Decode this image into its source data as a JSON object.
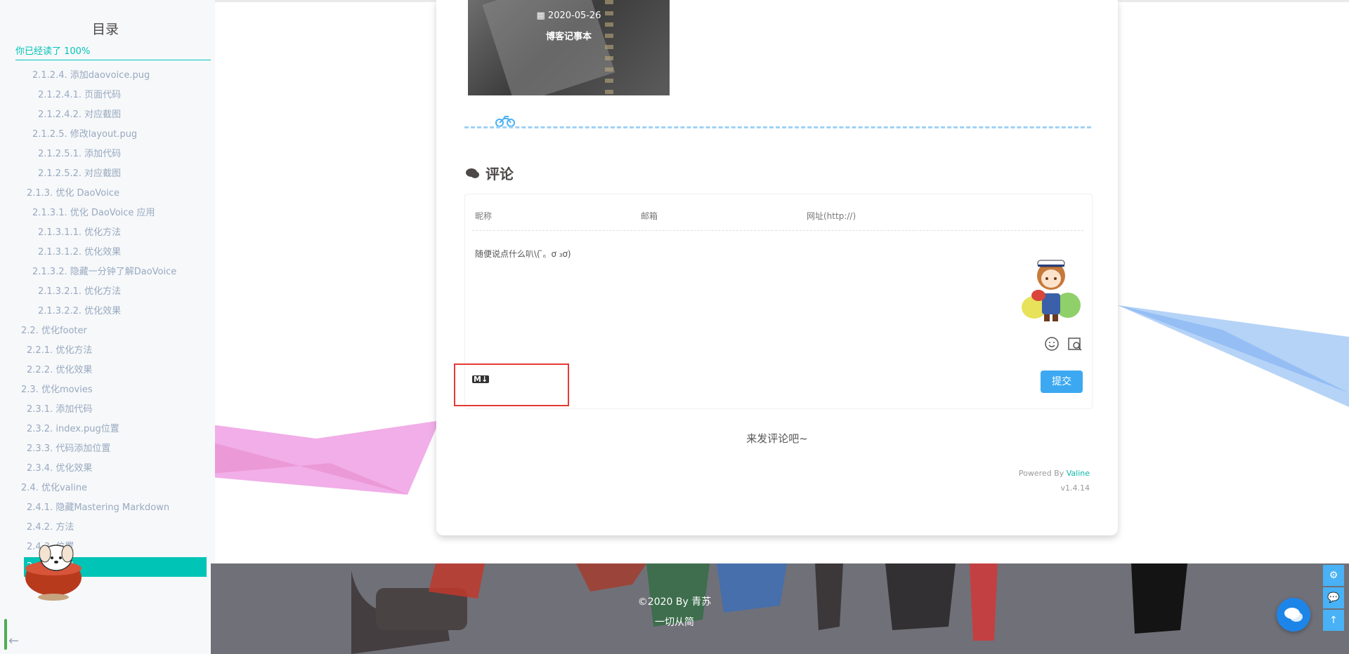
{
  "toc": {
    "title": "目录",
    "progress": "你已经读了  100%",
    "items": [
      {
        "label": "2.1.2.4. 添加daovoice.pug",
        "level": "lv4"
      },
      {
        "label": "2.1.2.4.1. 页面代码",
        "level": "lv5"
      },
      {
        "label": "2.1.2.4.2. 对应截图",
        "level": "lv5"
      },
      {
        "label": "2.1.2.5. 修改layout.pug",
        "level": "lv4"
      },
      {
        "label": "2.1.2.5.1. 添加代码",
        "level": "lv5"
      },
      {
        "label": "2.1.2.5.2. 对应截图",
        "level": "lv5"
      },
      {
        "label": "2.1.3. 优化 DaoVoice",
        "level": "lv3"
      },
      {
        "label": "2.1.3.1. 优化 DaoVoice 应用",
        "level": "lv4"
      },
      {
        "label": "2.1.3.1.1. 优化方法",
        "level": "lv5"
      },
      {
        "label": "2.1.3.1.2. 优化效果",
        "level": "lv5"
      },
      {
        "label": "2.1.3.2. 隐藏一分钟了解DaoVoice",
        "level": "lv4"
      },
      {
        "label": "2.1.3.2.1. 优化方法",
        "level": "lv5"
      },
      {
        "label": "2.1.3.2.2. 优化效果",
        "level": "lv5"
      },
      {
        "label": "2.2. 优化footer",
        "level": "lv2"
      },
      {
        "label": "2.2.1. 优化方法",
        "level": "lv3"
      },
      {
        "label": "2.2.2. 优化效果",
        "level": "lv3"
      },
      {
        "label": "2.3. 优化movies",
        "level": "lv2"
      },
      {
        "label": "2.3.1. 添加代码",
        "level": "lv3"
      },
      {
        "label": "2.3.2. index.pug位置",
        "level": "lv3"
      },
      {
        "label": "2.3.3. 代码添加位置",
        "level": "lv3"
      },
      {
        "label": "2.3.4. 优化效果",
        "level": "lv3"
      },
      {
        "label": "2.4. 优化valine",
        "level": "lv2"
      },
      {
        "label": "2.4.1. 隐藏Mastering Markdown",
        "level": "lv3"
      },
      {
        "label": "2.4.2. 方法",
        "level": "lv3"
      },
      {
        "label": "2.4.3. 位置",
        "level": "lv3"
      },
      {
        "label": "2.4.4. 效果",
        "level": "lv3",
        "active": true
      }
    ],
    "back_arrow": "←"
  },
  "related": {
    "date": "2020-05-26",
    "title": "博客记事本"
  },
  "comments": {
    "heading": "评论",
    "nick_placeholder": "昵称",
    "mail_placeholder": "邮箱",
    "url_placeholder": "网址(http://)",
    "textarea_placeholder": "随便说点什么叭\\( ̄。ơ ₃ơ)",
    "md_label": "M↓",
    "submit": "提交",
    "empty_hint": "来发评论吧~",
    "powered_prefix": "Powered By ",
    "powered_name": "Valine",
    "version": "v1.4.14"
  },
  "footer": {
    "copyright": "©2020 By 青苏",
    "motto": "一切从简"
  },
  "side_buttons": {
    "settings": "⚙",
    "comments": "💬",
    "top": "↑"
  },
  "colors": {
    "accent": "#49b1f5",
    "toc_active": "#00c4b6",
    "submit": "#3ca8f1",
    "highlight": "#e53935"
  }
}
